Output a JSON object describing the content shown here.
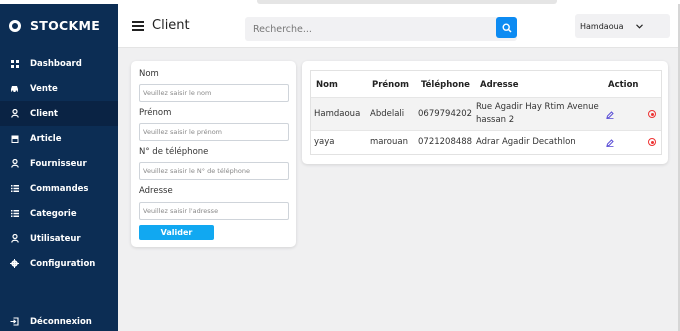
{
  "brand": {
    "name": "STOCKME"
  },
  "sidebar": {
    "items": [
      {
        "label": "Dashboard",
        "icon": "grid-icon"
      },
      {
        "label": "Vente",
        "icon": "car-icon"
      },
      {
        "label": "Client",
        "icon": "user-icon",
        "active": true
      },
      {
        "label": "Article",
        "icon": "box-icon"
      },
      {
        "label": "Fournisseur",
        "icon": "user-icon"
      },
      {
        "label": "Commandes",
        "icon": "list-icon"
      },
      {
        "label": "Categorie",
        "icon": "list-icon"
      },
      {
        "label": "Utilisateur",
        "icon": "user-icon"
      },
      {
        "label": "Configuration",
        "icon": "gear-icon"
      }
    ],
    "logout": {
      "label": "Déconnexion",
      "icon": "logout-icon"
    }
  },
  "header": {
    "title": "Client",
    "search": {
      "placeholder": "Recherche...",
      "value": ""
    },
    "user": {
      "name": "Hamdaoua"
    }
  },
  "form": {
    "fields": [
      {
        "label": "Nom",
        "placeholder": "Veuillez saisir le nom"
      },
      {
        "label": "Prénom",
        "placeholder": "Veuillez saisir le prénom"
      },
      {
        "label": "N° de téléphone",
        "placeholder": "Veuillez saisir le N° de téléphone"
      },
      {
        "label": "Adresse",
        "placeholder": "Veuillez saisir l'adresse"
      }
    ],
    "submit_label": "Valider"
  },
  "table": {
    "columns": [
      "Nom",
      "Prénom",
      "Téléphone",
      "Adresse",
      "Action"
    ],
    "rows": [
      {
        "nom": "Hamdaoua",
        "prenom": "Abdelali",
        "telephone": "0679794202",
        "adresse_line1": "Rue Agadir Hay Rtim Avenue",
        "adresse_line2": "hassan 2"
      },
      {
        "nom": "yaya",
        "prenom": "marouan",
        "telephone": "0721208488",
        "adresse_line1": "Adrar Agadir Decathlon",
        "adresse_line2": ""
      }
    ]
  },
  "colors": {
    "sidebar_bg": "#0c2d54",
    "accent": "#0d8bf2",
    "submit": "#11a8f1",
    "edit_icon": "#5b4fd6",
    "delete_icon": "#e33333"
  }
}
